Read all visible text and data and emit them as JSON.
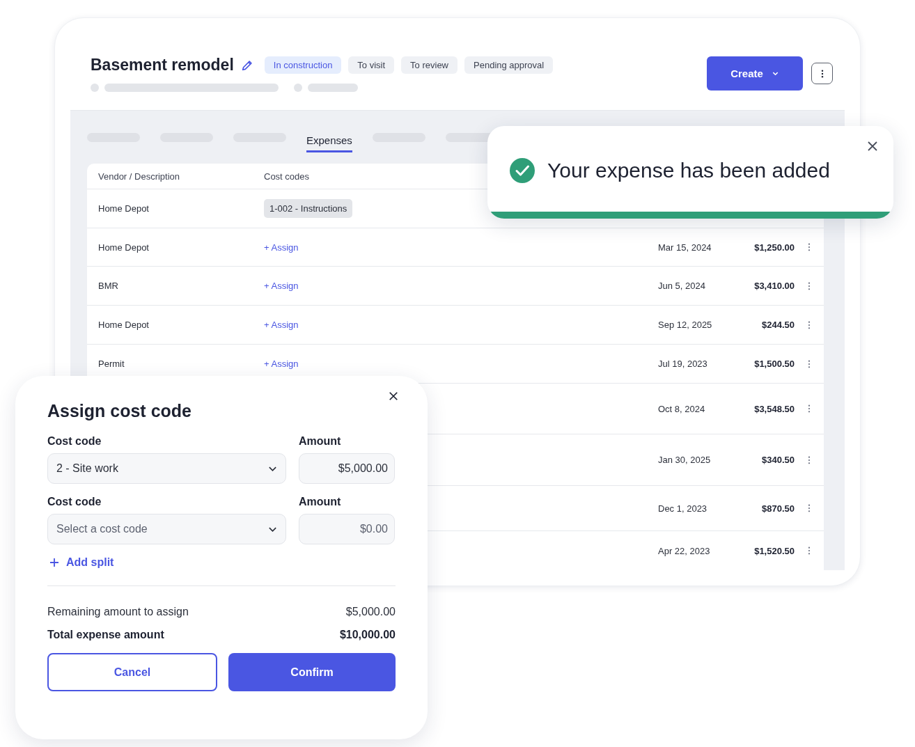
{
  "project": {
    "title": "Basement remodel",
    "statuses": [
      {
        "label": "In construction",
        "selected": true
      },
      {
        "label": "To visit",
        "selected": false
      },
      {
        "label": "To review",
        "selected": false
      },
      {
        "label": "Pending approval",
        "selected": false
      }
    ]
  },
  "create_button": "Create",
  "tabs": [
    {
      "label": "Expenses",
      "selected": true
    }
  ],
  "table": {
    "columns": [
      "Vendor / Description",
      "Cost codes"
    ],
    "rows": [
      {
        "vendor": "Home Depot",
        "cost_code": {
          "kind": "chip",
          "text": "1-002 - Instructions"
        }
      },
      {
        "vendor": "Home Depot",
        "cost_code": {
          "kind": "link",
          "text": "+ Assign"
        },
        "date": "Mar 15, 2024",
        "amount": "$1,250.00"
      },
      {
        "vendor": "BMR",
        "cost_code": {
          "kind": "link",
          "text": "+ Assign"
        },
        "date": "Jun 5, 2024",
        "amount": "$3,410.00"
      },
      {
        "vendor": "Home Depot",
        "cost_code": {
          "kind": "link",
          "text": "+ Assign"
        },
        "date": "Sep 12, 2025",
        "amount": "$244.50"
      },
      {
        "vendor": "Permit",
        "cost_code": {
          "kind": "link",
          "text": "+ Assign"
        },
        "date": "Jul 19, 2023",
        "amount": "$1,500.50"
      },
      {
        "date": "Oct 8, 2024",
        "amount": "$3,548.50"
      },
      {
        "date": "Jan 30, 2025",
        "amount": "$340.50"
      },
      {
        "date": "Dec 1, 2023",
        "amount": "$870.50"
      },
      {
        "date": "Apr 22, 2023",
        "amount": "$1,520.50"
      }
    ]
  },
  "toast": {
    "message": "Your expense has been added"
  },
  "assign_modal": {
    "title": "Assign cost code",
    "splits": [
      {
        "code_label": "Cost code",
        "code_value": "2 - Site work",
        "amount_label": "Amount",
        "amount_value": "$5,000.00"
      },
      {
        "code_label": "Cost code",
        "code_placeholder": "Select a cost code",
        "amount_label": "Amount",
        "amount_placeholder": "$0.00"
      }
    ],
    "add_split": "Add split",
    "remaining_label": "Remaining amount to assign",
    "remaining_value": "$5,000.00",
    "total_label": "Total expense amount",
    "total_value": "$10,000.00",
    "cancel": "Cancel",
    "confirm": "Confirm"
  }
}
